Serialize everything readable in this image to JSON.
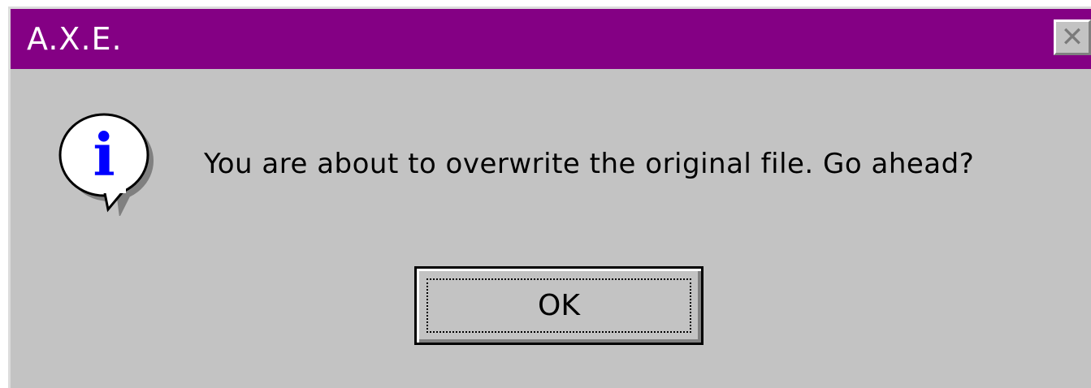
{
  "window": {
    "title": "A.X.E.",
    "close_glyph": "✕",
    "title_bar_color": "#840084",
    "body_color": "#c3c3c3"
  },
  "dialog": {
    "icon": "info-icon",
    "icon_glyph": "i",
    "icon_color": "#0000ff",
    "message": "You are about to overwrite the original file.  Go ahead?",
    "ok_label": "OK"
  }
}
